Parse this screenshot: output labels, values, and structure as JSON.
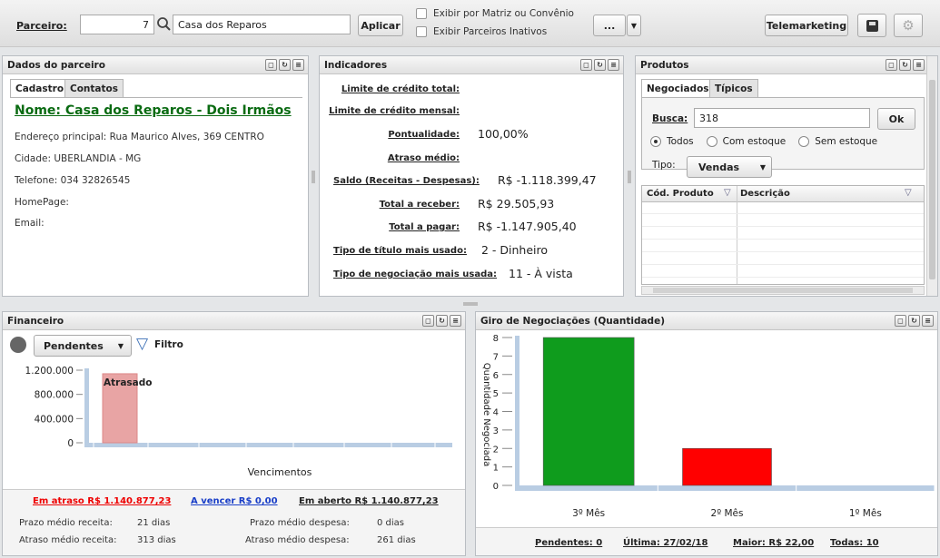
{
  "toolbar": {
    "partner_label": "Parceiro:",
    "partner_code": "7",
    "partner_name": "Casa dos Reparos",
    "apply_label": "Aplicar",
    "check_matrix": "Exibir por Matriz ou Convênio",
    "check_inactive": "Exibir Parceiros Inativos",
    "more_label": "...",
    "telemarketing_label": "Telemarketing"
  },
  "partner_panel": {
    "title": "Dados do parceiro",
    "tabs": [
      "Cadastro",
      "Contatos"
    ],
    "name": "Nome: Casa dos Reparos - Dois Irmãos",
    "address": "Endereço principal: Rua Maurico Alves, 369 CENTRO",
    "city": "Cidade: UBERLANDIA - MG",
    "phone": "Telefone: 034 32826545",
    "homepage": "HomePage:",
    "email": "Email:"
  },
  "indicators": {
    "title": "Indicadores",
    "items": [
      {
        "label": "Limite de crédito total:",
        "value": ""
      },
      {
        "label": "Limite de crédito mensal:",
        "value": ""
      },
      {
        "label": "Pontualidade:",
        "value": "100,00%"
      },
      {
        "label": "Atraso médio:",
        "value": ""
      },
      {
        "label": "Saldo (Receitas - Despesas):",
        "value": "R$ -1.118.399,47"
      },
      {
        "label": "Total a receber:",
        "value": "R$ 29.505,93"
      },
      {
        "label": "Total a pagar:",
        "value": "R$ -1.147.905,40"
      },
      {
        "label": "Tipo de título mais usado:",
        "value": "2 - Dinheiro"
      },
      {
        "label": "Tipo de negociação mais usada:",
        "value": "11 - À vista"
      }
    ]
  },
  "products": {
    "title": "Produtos",
    "tabs": [
      "Negociados",
      "Típicos"
    ],
    "search_label": "Busca:",
    "search_value": "318",
    "ok_label": "Ok",
    "radios": [
      "Todos",
      "Com estoque",
      "Sem estoque"
    ],
    "type_label": "Tipo:",
    "type_value": "Vendas",
    "col_code": "Cód. Produto",
    "col_desc": "Descrição"
  },
  "financial": {
    "title": "Financeiro",
    "filter_value": "Pendentes",
    "filter_label": "Filtro",
    "overdue_link": "Em atraso R$ 1.140.877,23",
    "due_link": "A vencer R$ 0,00",
    "open_link": "Em aberto R$ 1.140.877,23",
    "stats": [
      {
        "label": "Prazo médio receita:",
        "value": "21 dias"
      },
      {
        "label": "Prazo médio despesa:",
        "value": "0 dias"
      },
      {
        "label": "Atraso médio receita:",
        "value": "313 dias"
      },
      {
        "label": "Atraso médio despesa:",
        "value": "261 dias"
      }
    ]
  },
  "financial_chart": {
    "type": "bar",
    "categories": [
      "Atrasado"
    ],
    "values": [
      1140877.23
    ],
    "ylim": [
      0,
      1200000
    ],
    "yticks": [
      "1.200.000",
      "800.000",
      "400.000",
      "0"
    ],
    "xlabel": "Vencimentos",
    "ylabel": "",
    "bar_color": "#e8a4a4"
  },
  "turnover": {
    "title": "Giro de Negociações (Quantidade)",
    "ylabel": "Quantidade Negociada",
    "footer_pending": "Pendentes: 0",
    "footer_last": "Última: 27/02/18",
    "footer_max": "Maior: R$ 22,00",
    "footer_all": "Todas: 10"
  },
  "chart_data": {
    "type": "bar",
    "title": "Giro de Negociações (Quantidade)",
    "ylabel": "Quantidade Negociada",
    "categories": [
      "3º Mês",
      "2º Mês",
      "1º Mês"
    ],
    "values": [
      8,
      2,
      0
    ],
    "colors": [
      "#0f9c1d",
      "#ff0000",
      "#cccccc"
    ],
    "ylim": [
      0,
      8
    ],
    "yticks": [
      0,
      1,
      2,
      3,
      4,
      5,
      6,
      7,
      8
    ]
  }
}
